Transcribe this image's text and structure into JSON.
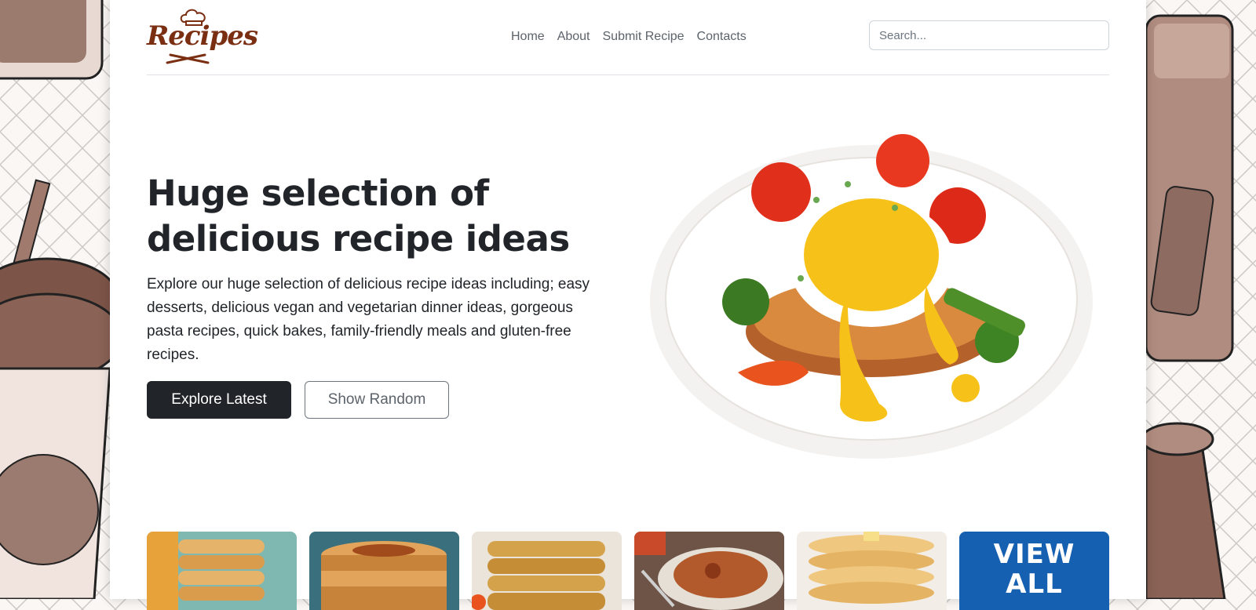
{
  "header": {
    "logo_text": "Recipes",
    "nav": [
      {
        "label": "Home"
      },
      {
        "label": "About"
      },
      {
        "label": "Submit Recipe"
      },
      {
        "label": "Contacts"
      }
    ],
    "search": {
      "placeholder": "Search..."
    }
  },
  "hero": {
    "title": "Huge selection of delicious recipe ideas",
    "description": "Explore our huge selection of delicious recipe ideas including; easy desserts, delicious vegan and vegetarian dinner ideas, gorgeous pasta recipes, quick bakes, family-friendly meals and gluten-free recipes.",
    "primary_button": "Explore Latest",
    "secondary_button": "Show Random"
  },
  "latest": {
    "view_all_line1": "VIEW",
    "view_all_line2": "ALL"
  },
  "colors": {
    "brand": "#7a2e12",
    "dark_button": "#212529",
    "view_all_bg": "#1560b0"
  }
}
